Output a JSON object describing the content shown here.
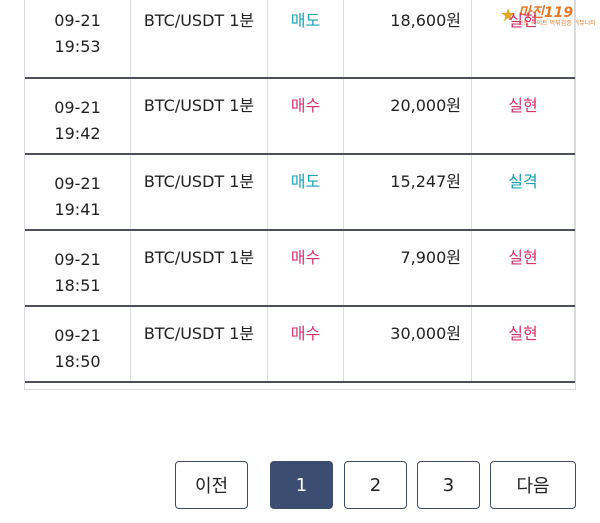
{
  "logo": {
    "star": "★",
    "text": "마진",
    "suffix": "119",
    "sub": "토토 사이트 먹튀검증 커뮤니티"
  },
  "rows": [
    {
      "date": "09-21",
      "time": "19:53",
      "symbol": "BTC/USDT 1분",
      "side": "매도",
      "side_type": "sell",
      "amount": "18,600원",
      "result": "실현",
      "result_type": "hit"
    },
    {
      "date": "09-21",
      "time": "19:42",
      "symbol": "BTC/USDT 1분",
      "side": "매수",
      "side_type": "buy",
      "amount": "20,000원",
      "result": "실현",
      "result_type": "hit"
    },
    {
      "date": "09-21",
      "time": "19:41",
      "symbol": "BTC/USDT 1분",
      "side": "매도",
      "side_type": "sell",
      "amount": "15,247원",
      "result": "실격",
      "result_type": "miss"
    },
    {
      "date": "09-21",
      "time": "18:51",
      "symbol": "BTC/USDT 1분",
      "side": "매수",
      "side_type": "buy",
      "amount": "7,900원",
      "result": "실현",
      "result_type": "hit"
    },
    {
      "date": "09-21",
      "time": "18:50",
      "symbol": "BTC/USDT 1분",
      "side": "매수",
      "side_type": "buy",
      "amount": "30,000원",
      "result": "실현",
      "result_type": "hit"
    }
  ],
  "pagination": {
    "prev": "이전",
    "pages": [
      "1",
      "2",
      "3"
    ],
    "active_page": "1",
    "next": "다음"
  },
  "colors": {
    "buy": "#d8326e",
    "sell": "#1aa3b0",
    "active_page_bg": "#3b4d70",
    "row_separator": "#4a5060"
  }
}
